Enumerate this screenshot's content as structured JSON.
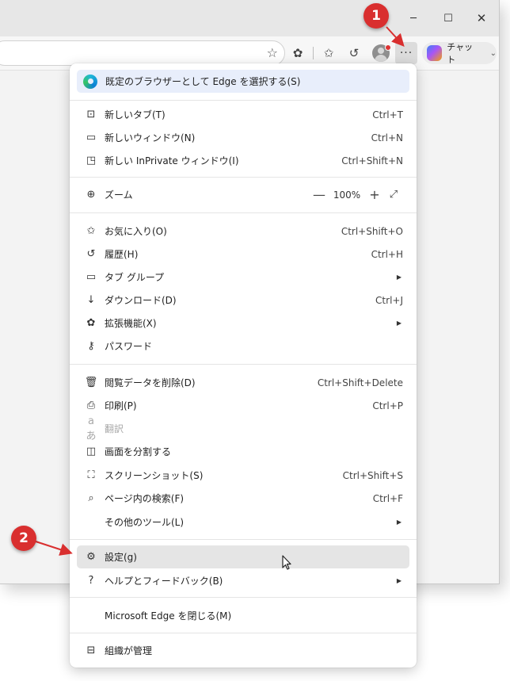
{
  "window": {
    "minimize_glyph": "─",
    "maximize_glyph": "☐",
    "close_glyph": "✕"
  },
  "toolbar": {
    "favorite_icon": "star-outline-icon",
    "chat_label": "チャット",
    "more_glyph": "···"
  },
  "callouts": {
    "step1": "1",
    "step2": "2"
  },
  "colors": {
    "callout": "#d92f2f",
    "banner": "#e8eefb",
    "hover": "#e5e5e5"
  },
  "menu": {
    "banner": "既定のブラウザーとして Edge を選択する(S)",
    "new_tab": {
      "label": "新しいタブ(T)",
      "shortcut": "Ctrl+T"
    },
    "new_window": {
      "label": "新しいウィンドウ(N)",
      "shortcut": "Ctrl+N"
    },
    "new_inprivate": {
      "label": "新しい InPrivate ウィンドウ(I)",
      "shortcut": "Ctrl+Shift+N"
    },
    "zoom": {
      "label": "ズーム",
      "value": "100%",
      "minus": "—",
      "plus": "+",
      "fullscreen": "⤢"
    },
    "favorites": {
      "label": "お気に入り(O)",
      "shortcut": "Ctrl+Shift+O"
    },
    "history": {
      "label": "履歴(H)",
      "shortcut": "Ctrl+H"
    },
    "tab_groups": {
      "label": "タブ グループ"
    },
    "downloads": {
      "label": "ダウンロード(D)",
      "shortcut": "Ctrl+J"
    },
    "extensions": {
      "label": "拡張機能(X)"
    },
    "passwords": {
      "label": "パスワード"
    },
    "clear_data": {
      "label": "閲覧データを削除(D)",
      "shortcut": "Ctrl+Shift+Delete"
    },
    "print": {
      "label": "印刷(P)",
      "shortcut": "Ctrl+P"
    },
    "translate": {
      "label": "翻訳"
    },
    "split_screen": {
      "label": "画面を分割する"
    },
    "screenshot": {
      "label": "スクリーンショット(S)",
      "shortcut": "Ctrl+Shift+S"
    },
    "find": {
      "label": "ページ内の検索(F)",
      "shortcut": "Ctrl+F"
    },
    "more_tools": {
      "label": "その他のツール(L)"
    },
    "settings": {
      "label": "設定(g)"
    },
    "help": {
      "label": "ヘルプとフィードバック(B)"
    },
    "close_edge": {
      "label": "Microsoft Edge を閉じる(M)"
    },
    "managed": {
      "label": "組織が管理"
    },
    "submenu_arrow": "▶"
  }
}
